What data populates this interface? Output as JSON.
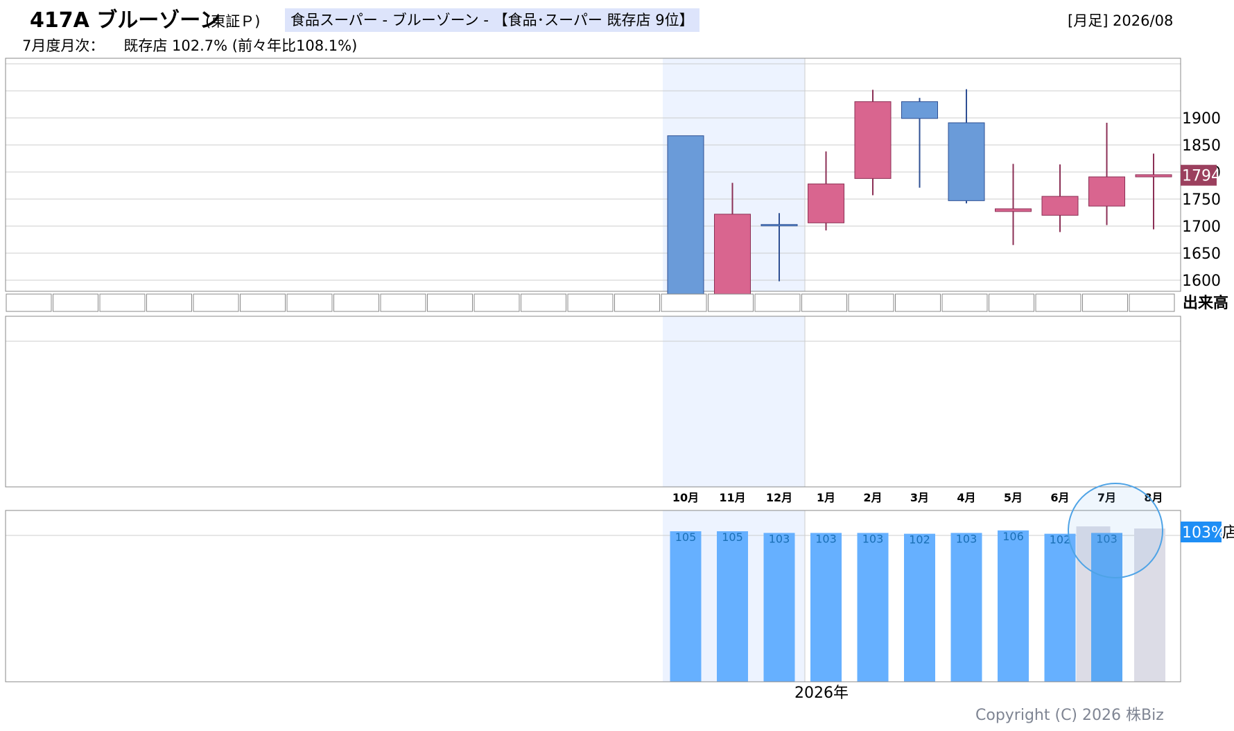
{
  "header": {
    "ticker": "417A ブルーゾーン",
    "market": "(東証Ｐ)",
    "sector": "食品スーパー - ブルーゾーン - 【食品･スーパー 既存店 9位】",
    "period": "[月足] 2026/08",
    "monthly_label": "7月度月次：",
    "monthly_value": "既存店 102.7% (前々年比108.1%)"
  },
  "volume_label": "出来高",
  "year_label": "2026年",
  "copyright": "Copyright (C) 2026 株Biz",
  "colors": {
    "up": "#d9658f",
    "up_edge": "#8b2f55",
    "down": "#6a9bd9",
    "down_edge": "#2e4f93",
    "bar": "#66b0ff",
    "bar_highlight": "#5aa8f5",
    "future_bar": "#dcdce6",
    "shade": "#edf3ff",
    "last_price_bg": "#9b405e",
    "pct_badge_bg": "#1e8ef5",
    "circle": "#4ea3e6"
  },
  "chart_data": [
    {
      "type": "candlestick",
      "categories": [
        "10月",
        "11月",
        "12月",
        "1月",
        "2月",
        "3月",
        "4月",
        "5月",
        "6月",
        "7月",
        "8月"
      ],
      "open": [
        1867,
        1563,
        1703,
        1706,
        1788,
        1930,
        1891,
        1727,
        1720,
        1737,
        1791
      ],
      "close": [
        1570,
        1722,
        1702,
        1778,
        1930,
        1899,
        1747,
        1732,
        1755,
        1791,
        1795
      ],
      "high": [
        1867,
        1780,
        1724,
        1838,
        1952,
        1937,
        1953,
        1815,
        1814,
        1891,
        1834
      ],
      "low": [
        1555,
        1542,
        1598,
        1692,
        1757,
        1771,
        1742,
        1665,
        1689,
        1702,
        1694
      ],
      "y_ticks": [
        1600,
        1650,
        1700,
        1750,
        1800,
        1850,
        1900
      ],
      "y_tick_labels": [
        "1600",
        "1650",
        "1700",
        "1750",
        "1900",
        "1850",
        "1900"
      ],
      "ylim": [
        1550,
        1960
      ],
      "last_price": "1794"
    },
    {
      "type": "bar",
      "categories": [
        "10月",
        "11月",
        "12月",
        "1月",
        "2月",
        "3月",
        "4月",
        "5月",
        "6月",
        "7月",
        "8月"
      ],
      "values": [
        105,
        105,
        103,
        103,
        103,
        102,
        103,
        106,
        102,
        103,
        null
      ],
      "value_labels": [
        "105",
        "105",
        "103",
        "103",
        "103",
        "102",
        "103",
        "106",
        "102",
        "103",
        ""
      ],
      "highlight_label": "103%",
      "highlight_suffix": "店"
    }
  ]
}
